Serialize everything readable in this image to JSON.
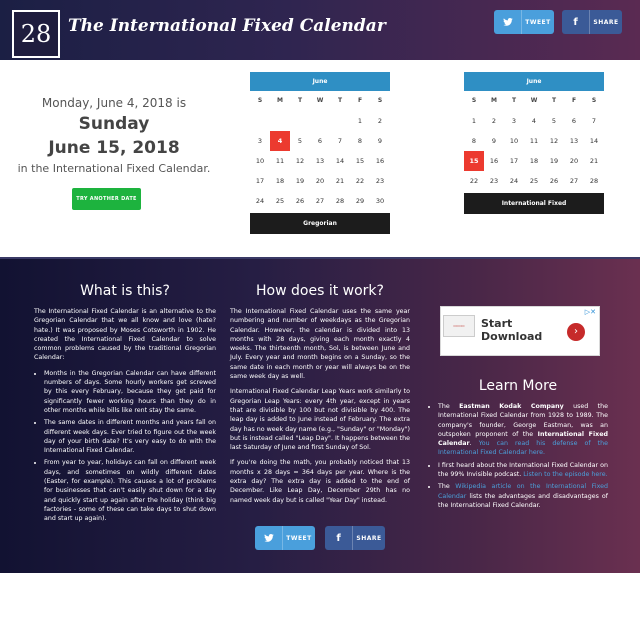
{
  "header": {
    "logo_number": "28",
    "title": "The International Fixed Calendar",
    "tweet_label": "TWEET",
    "share_label": "SHARE",
    "twitter_icon": "twitter-bird-icon",
    "facebook_icon": "facebook-f-icon"
  },
  "converter": {
    "gregorian_date": "Monday, June 4, 2018 is",
    "day_name": "Sunday",
    "fixed_date": "June 15, 2018",
    "suffix": "in the International Fixed Calendar.",
    "try_button": "TRY ANOTHER DATE"
  },
  "calendars": [
    {
      "month": "June",
      "footer": "Gregorian",
      "weekdays": [
        "S",
        "M",
        "T",
        "W",
        "T",
        "F",
        "S"
      ],
      "cells": [
        "",
        "",
        "",
        "",
        "",
        "1",
        "2",
        "3",
        "4",
        "5",
        "6",
        "7",
        "8",
        "9",
        "10",
        "11",
        "12",
        "13",
        "14",
        "15",
        "16",
        "17",
        "18",
        "19",
        "20",
        "21",
        "22",
        "23",
        "24",
        "25",
        "26",
        "27",
        "28",
        "29",
        "30"
      ],
      "highlight": "4"
    },
    {
      "month": "June",
      "footer": "International Fixed",
      "weekdays": [
        "S",
        "M",
        "T",
        "W",
        "T",
        "F",
        "S"
      ],
      "cells": [
        "1",
        "2",
        "3",
        "4",
        "5",
        "6",
        "7",
        "8",
        "9",
        "10",
        "11",
        "12",
        "13",
        "14",
        "15",
        "16",
        "17",
        "18",
        "19",
        "20",
        "21",
        "22",
        "23",
        "24",
        "25",
        "26",
        "27",
        "28"
      ],
      "highlight": "15"
    }
  ],
  "what": {
    "heading": "What is this?",
    "intro": "The International Fixed Calendar is an alternative to the Gregorian Calendar that we all know and love (hate? hate.) It was proposed by Moses Cotsworth in 1902. He created the International Fixed Calendar to solve common problems caused by the traditional Gregorian Calendar:",
    "bullets": [
      "Months in the Gregorian Calendar can have different numbers of days. Some hourly workers get screwed by this every February, because they get paid for significantly fewer working hours than they do in other months while bills like rent stay the same.",
      "The same dates in different months and years fall on different week days. Ever tried to figure out the week day of your birth date? It's very easy to do with the International Fixed Calendar.",
      "From year to year, holidays can fall on different week days, and sometimes on wildly different dates (Easter, for example). This causes a lot of problems for businesses that can't easily shut down for a day and quickly start up again after the holiday (think big factories - some of these can take days to shut down and start up again)."
    ]
  },
  "how": {
    "heading": "How does it work?",
    "p1": "The International Fixed Calendar uses the same year numbering and number of weekdays as the Gregorian Calendar. However, the calendar is divided into 13 months with 28 days, giving each month exactly 4 weeks. The thirteenth month, Sol, is between June and July. Every year and month begins on a Sunday, so the same date in each month or year will always be on the same week day as well.",
    "p2": "International Fixed Calendar Leap Years work similarly to Gregorian Leap Years: every 4th year, except in years that are divisible by 100 but not divisible by 400. The leap day is added to June instead of February. The extra day has no week day name (e.g., \"Sunday\" or \"Monday\") but is instead called \"Leap Day\". It happens between the last Saturday of June and first Sunday of Sol.",
    "p3": "If you're doing the math, you probably noticed that 13 months x 28 days = 364 days per year. Where is the extra day? The extra day is added to the end of December. Like Leap Day, December 29th has no named week day but is called \"Year Day\" instead."
  },
  "ad": {
    "text_line1": "Start",
    "text_line2": "Download",
    "arrow_icon": "chevron-right-icon",
    "close_icon": "adchoices-close-icon"
  },
  "learn": {
    "heading": "Learn More",
    "item1_pre": "The ",
    "item1_bold": "Eastman Kodak Company",
    "item1_mid": " used the International Fixed Calendar from 1928 to 1989. The company's founder, George Eastman, was an outspoken proponent of the ",
    "item1_bold2": "International Fixed Calendar",
    "item1_post": ". ",
    "item1_link": "You can read his defense of the International Fixed Calendar here.",
    "item2_pre": "I first heard about the International Fixed Calendar on the 99% Invisible podcast. ",
    "item2_link": "Listen to the episode here.",
    "item3_pre": "The ",
    "item3_link": "Wikipedia article on the International Fixed Calendar",
    "item3_post": " lists the advantages and disadvantages of the International Fixed Calendar."
  },
  "bottom_share": {
    "tweet_label": "TWEET",
    "share_label": "SHARE"
  },
  "colors": {
    "accent_blue": "#2f8fc4",
    "highlight_red": "#ec3a2f",
    "try_green": "#1db33e",
    "twitter": "#4a9fdc",
    "facebook": "#3b5a97"
  }
}
